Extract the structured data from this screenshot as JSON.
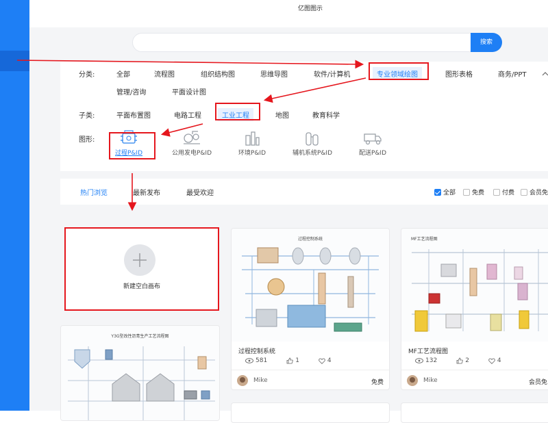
{
  "app": {
    "title": "亿图图示"
  },
  "search": {
    "placeholder": "",
    "button": "搜索"
  },
  "category": {
    "label": "分类:",
    "items": [
      "全部",
      "流程图",
      "组织结构图",
      "思维导图",
      "软件/计算机",
      "专业领域绘图",
      "图形表格",
      "商务/PPT",
      "管理/咨询",
      "平面设计图"
    ],
    "selected": "专业领域绘图"
  },
  "subcategory": {
    "label": "子类:",
    "items": [
      "平面布置图",
      "电路工程",
      "工业工程",
      "地图",
      "教育科学"
    ],
    "selected": "工业工程"
  },
  "shapes": {
    "label": "图形:",
    "items": [
      {
        "label": "过程P&ID",
        "icon": "process-pid-icon"
      },
      {
        "label": "公用发电P&ID",
        "icon": "power-generation-icon"
      },
      {
        "label": "环境P&ID",
        "icon": "environment-icon"
      },
      {
        "label": "辅机系统P&ID",
        "icon": "auxiliary-system-icon"
      },
      {
        "label": "配送P&ID",
        "icon": "delivery-truck-icon"
      }
    ],
    "selected": "过程P&ID"
  },
  "tabs": [
    "热门浏览",
    "最新发布",
    "最受欢迎"
  ],
  "active_tab": "热门浏览",
  "price_filters": [
    {
      "label": "全部",
      "checked": true
    },
    {
      "label": "免费",
      "checked": false
    },
    {
      "label": "付费",
      "checked": false
    },
    {
      "label": "会员免",
      "checked": false
    }
  ],
  "new_canvas": {
    "label": "新建空白画布"
  },
  "cards": [
    {
      "thumb_title": "过程控制系统",
      "title": "过程控制系统",
      "views": "581",
      "likes": "1",
      "favorites": "4",
      "author": "Mike",
      "price": "免费"
    },
    {
      "thumb_title": "MF工艺流程图",
      "title": "MF工艺流程图",
      "views": "132",
      "likes": "2",
      "favorites": "4",
      "author": "Mike",
      "price": "会员免"
    },
    {
      "thumb_title": "Y3G型改性沥青生产工艺流程图"
    }
  ],
  "colors": {
    "accent": "#1e7ff5",
    "annotation": "#e5161d",
    "sidebar": "#1e7ff5"
  }
}
